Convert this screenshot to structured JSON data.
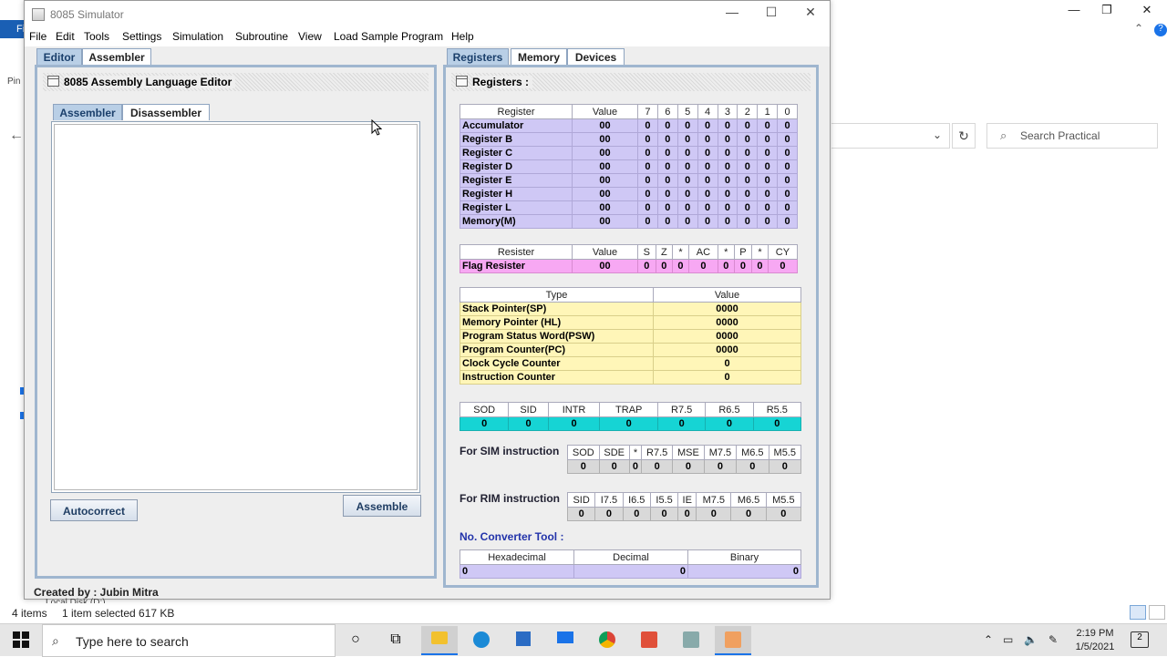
{
  "background": {
    "tab_label": "Fi",
    "pin_label": "Pin",
    "search_placeholder": "Search Practical",
    "status_items": "4 items",
    "status_selected": "1 item selected  617 KB",
    "local_disk": "Local Disk (D:)",
    "help_label": "?"
  },
  "window": {
    "title": "8085 Simulator",
    "menu": [
      "File",
      "Edit",
      "Tools",
      "Settings",
      "Simulation",
      "Subroutine",
      "View",
      "Load Sample Program",
      "Help"
    ]
  },
  "left": {
    "tabs": [
      "Editor",
      "Assembler"
    ],
    "panel_title": "8085 Assembly Language Editor",
    "subtabs": [
      "Assembler",
      "Disassembler"
    ],
    "autocorrect_label": "Autocorrect",
    "assemble_label": "Assemble",
    "created_by": "Created by : Jubin Mitra"
  },
  "right": {
    "tabs": [
      "Registers",
      "Memory",
      "Devices"
    ],
    "panel_title": "Registers :",
    "register_headers": [
      "Register",
      "Value",
      "7",
      "6",
      "5",
      "4",
      "3",
      "2",
      "1",
      "0"
    ],
    "registers": [
      {
        "name": "Accumulator",
        "value": "00",
        "bits": [
          "0",
          "0",
          "0",
          "0",
          "0",
          "0",
          "0",
          "0"
        ]
      },
      {
        "name": "Register B",
        "value": "00",
        "bits": [
          "0",
          "0",
          "0",
          "0",
          "0",
          "0",
          "0",
          "0"
        ]
      },
      {
        "name": "Register C",
        "value": "00",
        "bits": [
          "0",
          "0",
          "0",
          "0",
          "0",
          "0",
          "0",
          "0"
        ]
      },
      {
        "name": "Register D",
        "value": "00",
        "bits": [
          "0",
          "0",
          "0",
          "0",
          "0",
          "0",
          "0",
          "0"
        ]
      },
      {
        "name": "Register E",
        "value": "00",
        "bits": [
          "0",
          "0",
          "0",
          "0",
          "0",
          "0",
          "0",
          "0"
        ]
      },
      {
        "name": "Register H",
        "value": "00",
        "bits": [
          "0",
          "0",
          "0",
          "0",
          "0",
          "0",
          "0",
          "0"
        ]
      },
      {
        "name": "Register L",
        "value": "00",
        "bits": [
          "0",
          "0",
          "0",
          "0",
          "0",
          "0",
          "0",
          "0"
        ]
      },
      {
        "name": "Memory(M)",
        "value": "00",
        "bits": [
          "0",
          "0",
          "0",
          "0",
          "0",
          "0",
          "0",
          "0"
        ]
      }
    ],
    "flag_headers": [
      "Resister",
      "Value",
      "S",
      "Z",
      "*",
      "AC",
      "*",
      "P",
      "*",
      "CY"
    ],
    "flag_row": {
      "name": "Flag Resister",
      "value": "00",
      "bits": [
        "0",
        "0",
        "0",
        "0",
        "0",
        "0",
        "0",
        "0"
      ]
    },
    "type_headers": [
      "Type",
      "Value"
    ],
    "types": [
      {
        "name": "Stack Pointer(SP)",
        "value": "0000"
      },
      {
        "name": "Memory Pointer (HL)",
        "value": "0000"
      },
      {
        "name": "Program Status Word(PSW)",
        "value": "0000"
      },
      {
        "name": "Program Counter(PC)",
        "value": "0000"
      },
      {
        "name": "Clock Cycle Counter",
        "value": "0"
      },
      {
        "name": "Instruction Counter",
        "value": "0"
      }
    ],
    "interrupt_headers": [
      "SOD",
      "SID",
      "INTR",
      "TRAP",
      "R7.5",
      "R6.5",
      "R5.5"
    ],
    "interrupt_values": [
      "0",
      "0",
      "0",
      "0",
      "0",
      "0",
      "0"
    ],
    "sim_label": "For SIM instruction",
    "sim_headers": [
      "SOD",
      "SDE",
      "*",
      "R7.5",
      "MSE",
      "M7.5",
      "M6.5",
      "M5.5"
    ],
    "sim_values": [
      "0",
      "0",
      "0",
      "0",
      "0",
      "0",
      "0",
      "0"
    ],
    "rim_label": "For RIM instruction",
    "rim_headers": [
      "SID",
      "I7.5",
      "I6.5",
      "I5.5",
      "IE",
      "M7.5",
      "M6.5",
      "M5.5"
    ],
    "rim_values": [
      "0",
      "0",
      "0",
      "0",
      "0",
      "0",
      "0",
      "0"
    ],
    "converter_label": "No. Converter Tool :",
    "converter_headers": [
      "Hexadecimal",
      "Decimal",
      "Binary"
    ],
    "converter_values": [
      "0",
      "0",
      "0"
    ]
  },
  "taskbar": {
    "search_placeholder": "Type here to search",
    "time": "2:19 PM",
    "date": "1/5/2021",
    "notification_count": "2"
  },
  "colors": {
    "register_row": "#cfc8f5",
    "flag_row": "#f7a8f3",
    "type_row": "#fff6b8",
    "interrupt_row": "#16d4d4",
    "active_tab": "#b9cfe6"
  }
}
